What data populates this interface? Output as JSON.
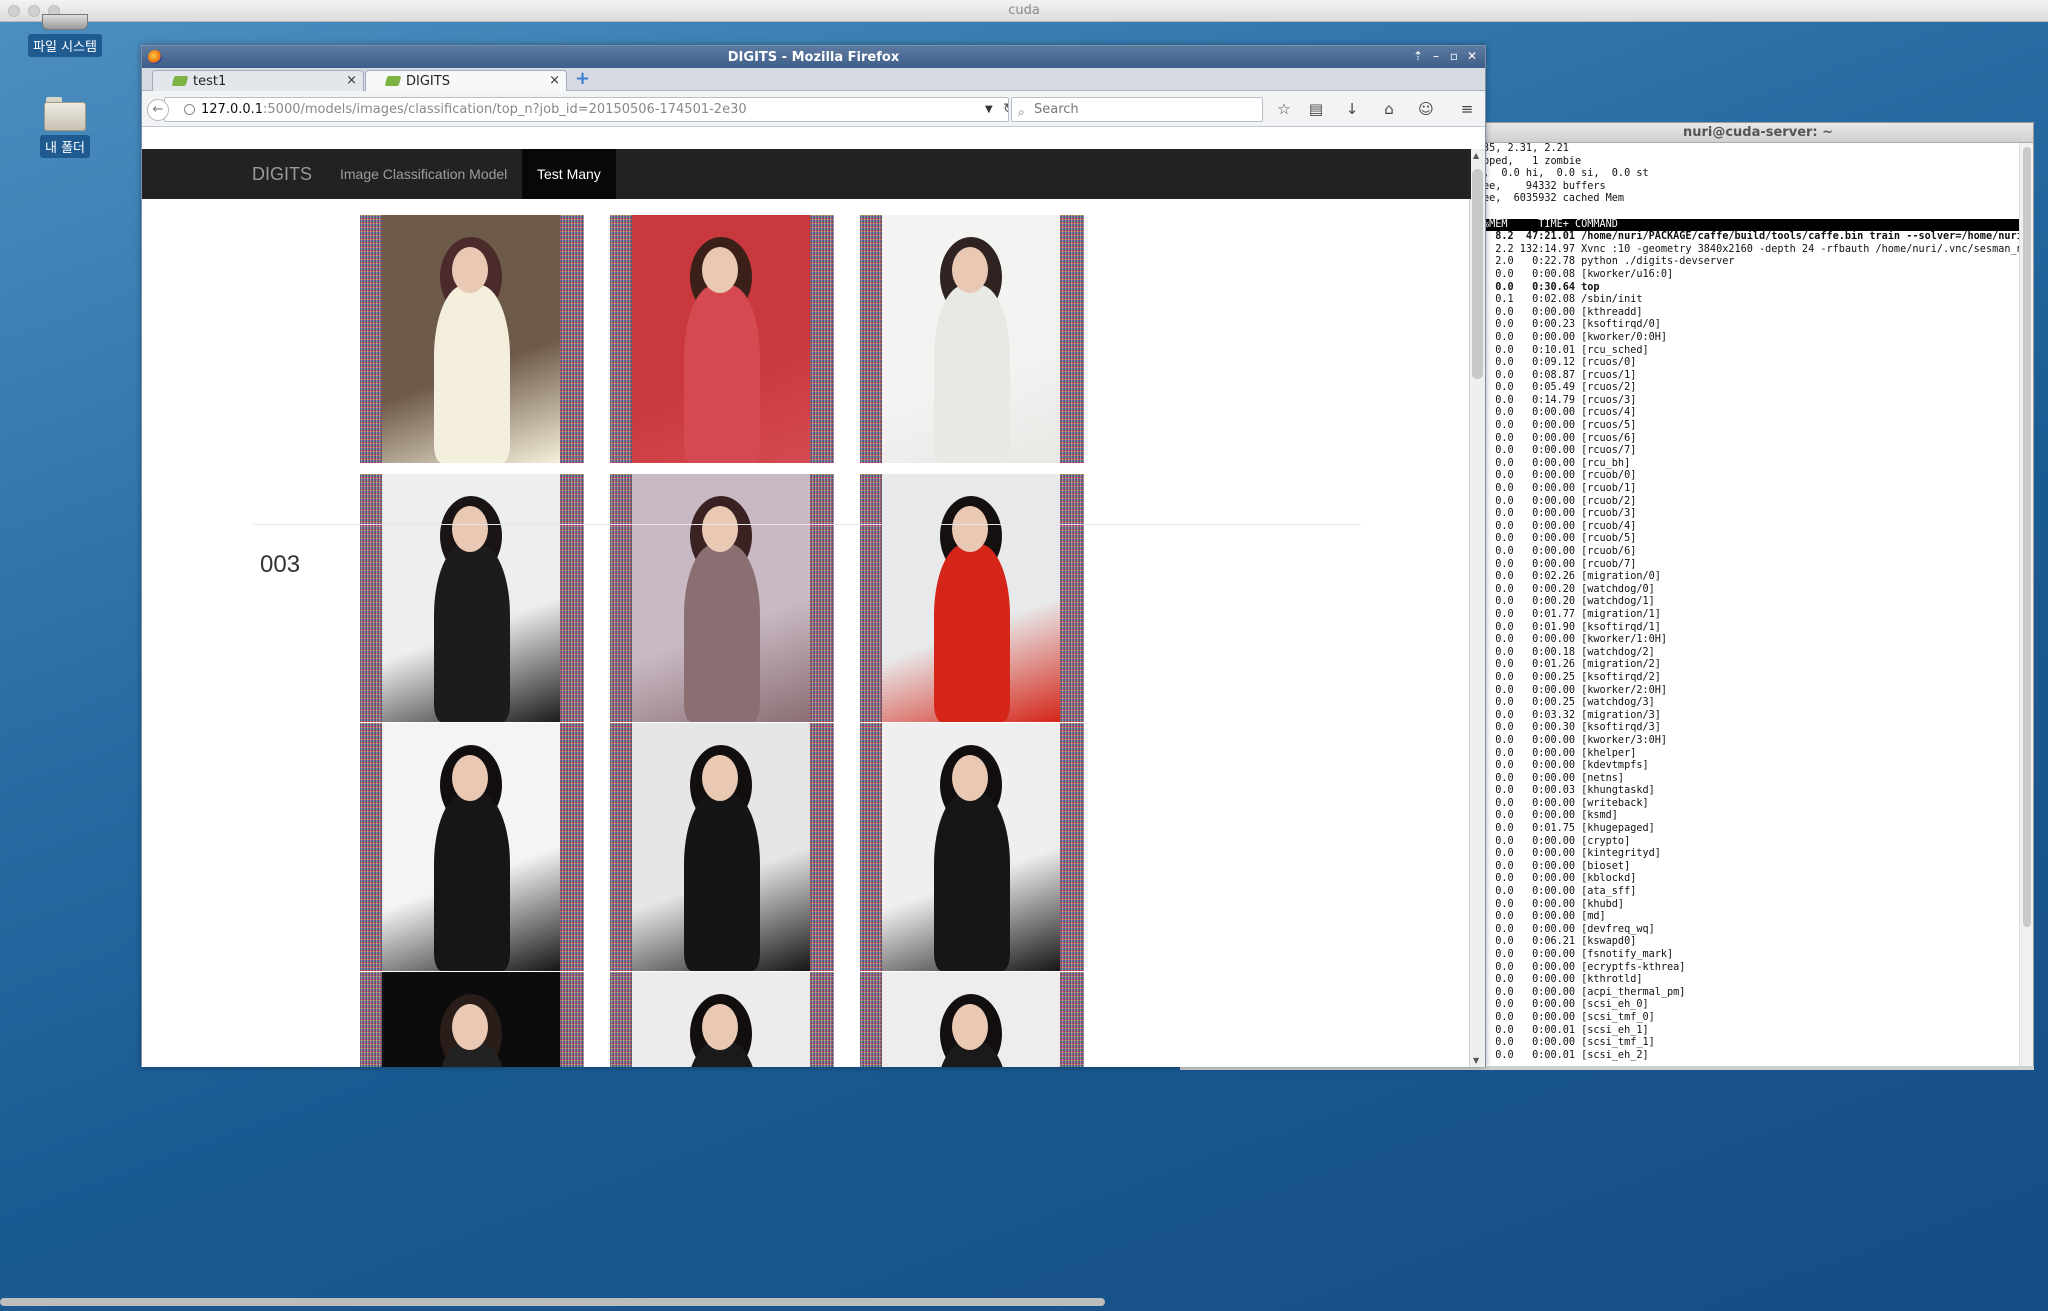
{
  "desktop": {
    "title": "cuda",
    "icons": [
      {
        "label": "파일 시스템"
      },
      {
        "label": "내 폴더"
      }
    ]
  },
  "terminal": {
    "title": "nuri@cuda-server: ~",
    "summary_lines": [
      "35, 2.31, 2.21",
      "pped,   1 zombie",
      ",  0.0 hi,  0.0 si,  0.0 st",
      "ee,    94332 buffers",
      "ee,  6035932 cached Mem"
    ],
    "header": "%MEM     TIME+ COMMAND",
    "rows": [
      {
        "mem": "8.2",
        "time": "47:21.01",
        "cmd": "/home/nuri/PACKAGE/caffe/build/tools/caffe.bin train --solver=/home/nuri/.digi",
        "bold": true
      },
      {
        "mem": "2.2",
        "time": "132:14.97",
        "cmd": "Xvnc :10 -geometry 3840x2160 -depth 24 -rfbauth /home/nuri/.vnc/sesman_nuri_pa"
      },
      {
        "mem": "2.0",
        "time": "0:22.78",
        "cmd": "python ./digits-devserver"
      },
      {
        "mem": "0.0",
        "time": "0:00.08",
        "cmd": "[kworker/u16:0]"
      },
      {
        "mem": "0.0",
        "time": "0:30.64",
        "cmd": "top",
        "bold": true
      },
      {
        "mem": "0.1",
        "time": "0:02.08",
        "cmd": "/sbin/init"
      },
      {
        "mem": "0.0",
        "time": "0:00.00",
        "cmd": "[kthreadd]"
      },
      {
        "mem": "0.0",
        "time": "0:00.23",
        "cmd": "[ksoftirqd/0]"
      },
      {
        "mem": "0.0",
        "time": "0:00.00",
        "cmd": "[kworker/0:0H]"
      },
      {
        "mem": "0.0",
        "time": "0:10.01",
        "cmd": "[rcu_sched]"
      },
      {
        "mem": "0.0",
        "time": "0:09.12",
        "cmd": "[rcuos/0]"
      },
      {
        "mem": "0.0",
        "time": "0:08.87",
        "cmd": "[rcuos/1]"
      },
      {
        "mem": "0.0",
        "time": "0:05.49",
        "cmd": "[rcuos/2]"
      },
      {
        "mem": "0.0",
        "time": "0:14.79",
        "cmd": "[rcuos/3]"
      },
      {
        "mem": "0.0",
        "time": "0:00.00",
        "cmd": "[rcuos/4]"
      },
      {
        "mem": "0.0",
        "time": "0:00.00",
        "cmd": "[rcuos/5]"
      },
      {
        "mem": "0.0",
        "time": "0:00.00",
        "cmd": "[rcuos/6]"
      },
      {
        "mem": "0.0",
        "time": "0:00.00",
        "cmd": "[rcuos/7]"
      },
      {
        "mem": "0.0",
        "time": "0:00.00",
        "cmd": "[rcu_bh]"
      },
      {
        "mem": "0.0",
        "time": "0:00.00",
        "cmd": "[rcuob/0]"
      },
      {
        "mem": "0.0",
        "time": "0:00.00",
        "cmd": "[rcuob/1]"
      },
      {
        "mem": "0.0",
        "time": "0:00.00",
        "cmd": "[rcuob/2]"
      },
      {
        "mem": "0.0",
        "time": "0:00.00",
        "cmd": "[rcuob/3]"
      },
      {
        "mem": "0.0",
        "time": "0:00.00",
        "cmd": "[rcuob/4]"
      },
      {
        "mem": "0.0",
        "time": "0:00.00",
        "cmd": "[rcuob/5]"
      },
      {
        "mem": "0.0",
        "time": "0:00.00",
        "cmd": "[rcuob/6]"
      },
      {
        "mem": "0.0",
        "time": "0:00.00",
        "cmd": "[rcuob/7]"
      },
      {
        "mem": "0.0",
        "time": "0:02.26",
        "cmd": "[migration/0]"
      },
      {
        "mem": "0.0",
        "time": "0:00.20",
        "cmd": "[watchdog/0]"
      },
      {
        "mem": "0.0",
        "time": "0:00.20",
        "cmd": "[watchdog/1]"
      },
      {
        "mem": "0.0",
        "time": "0:01.77",
        "cmd": "[migration/1]"
      },
      {
        "mem": "0.0",
        "time": "0:01.90",
        "cmd": "[ksoftirqd/1]"
      },
      {
        "mem": "0.0",
        "time": "0:00.00",
        "cmd": "[kworker/1:0H]"
      },
      {
        "mem": "0.0",
        "time": "0:00.18",
        "cmd": "[watchdog/2]"
      },
      {
        "mem": "0.0",
        "time": "0:01.26",
        "cmd": "[migration/2]"
      },
      {
        "mem": "0.0",
        "time": "0:00.25",
        "cmd": "[ksoftirqd/2]"
      },
      {
        "mem": "0.0",
        "time": "0:00.00",
        "cmd": "[kworker/2:0H]"
      },
      {
        "mem": "0.0",
        "time": "0:00.25",
        "cmd": "[watchdog/3]"
      },
      {
        "mem": "0.0",
        "time": "0:03.32",
        "cmd": "[migration/3]"
      },
      {
        "mem": "0.0",
        "time": "0:00.30",
        "cmd": "[ksoftirqd/3]"
      },
      {
        "mem": "0.0",
        "time": "0:00.00",
        "cmd": "[kworker/3:0H]"
      },
      {
        "mem": "0.0",
        "time": "0:00.00",
        "cmd": "[khelper]"
      },
      {
        "mem": "0.0",
        "time": "0:00.00",
        "cmd": "[kdevtmpfs]"
      },
      {
        "mem": "0.0",
        "time": "0:00.00",
        "cmd": "[netns]"
      },
      {
        "mem": "0.0",
        "time": "0:00.03",
        "cmd": "[khungtaskd]"
      },
      {
        "mem": "0.0",
        "time": "0:00.00",
        "cmd": "[writeback]"
      },
      {
        "mem": "0.0",
        "time": "0:00.00",
        "cmd": "[ksmd]"
      },
      {
        "mem": "0.0",
        "time": "0:01.75",
        "cmd": "[khugepaged]"
      },
      {
        "mem": "0.0",
        "time": "0:00.00",
        "cmd": "[crypto]"
      },
      {
        "mem": "0.0",
        "time": "0:00.00",
        "cmd": "[kintegrityd]"
      },
      {
        "mem": "0.0",
        "time": "0:00.00",
        "cmd": "[bioset]"
      },
      {
        "mem": "0.0",
        "time": "0:00.00",
        "cmd": "[kblockd]"
      },
      {
        "mem": "0.0",
        "time": "0:00.00",
        "cmd": "[ata_sff]"
      },
      {
        "mem": "0.0",
        "time": "0:00.00",
        "cmd": "[khubd]"
      },
      {
        "mem": "0.0",
        "time": "0:00.00",
        "cmd": "[md]"
      },
      {
        "mem": "0.0",
        "time": "0:00.00",
        "cmd": "[devfreq_wq]"
      },
      {
        "mem": "0.0",
        "time": "0:06.21",
        "cmd": "[kswapd0]"
      },
      {
        "mem": "0.0",
        "time": "0:00.00",
        "cmd": "[fsnotify_mark]"
      },
      {
        "mem": "0.0",
        "time": "0:00.00",
        "cmd": "[ecryptfs-kthrea]"
      },
      {
        "mem": "0.0",
        "time": "0:00.00",
        "cmd": "[kthrotld]"
      },
      {
        "mem": "0.0",
        "time": "0:00.00",
        "cmd": "[acpi_thermal_pm]"
      },
      {
        "mem": "0.0",
        "time": "0:00.00",
        "cmd": "[scsi_eh_0]"
      },
      {
        "mem": "0.0",
        "time": "0:00.00",
        "cmd": "[scsi_tmf_0]"
      },
      {
        "mem": "0.0",
        "time": "0:00.01",
        "cmd": "[scsi_eh_1]"
      },
      {
        "mem": "0.0",
        "time": "0:00.00",
        "cmd": "[scsi_tmf_1]"
      },
      {
        "mem": "0.0",
        "time": "0:00.01",
        "cmd": "[scsi_eh_2]"
      }
    ]
  },
  "firefox": {
    "window_title": "DIGITS - Mozilla Firefox",
    "tabs": [
      {
        "label": "test1"
      },
      {
        "label": "DIGITS"
      }
    ],
    "tab_close": "×",
    "new_tab": "+",
    "url_host": "127.0.0.1",
    "url_rest": ":5000/models/images/classification/top_n?job_id=20150506-174501-2e30",
    "search_placeholder": "Search",
    "icons": [
      "back-icon",
      "bookmark-star-icon",
      "reading-list-icon",
      "download-icon",
      "home-icon",
      "chat-icon",
      "menu-icon"
    ]
  },
  "digits": {
    "brand": "DIGITS",
    "nav_model": "Image Classification Model",
    "nav_active": "Test Many",
    "category_label": "003"
  },
  "colors": {
    "desktop_bg": "#1f5f97",
    "digits_nav_bg": "#222222",
    "firefox_titlebar": "#4a6a95"
  }
}
